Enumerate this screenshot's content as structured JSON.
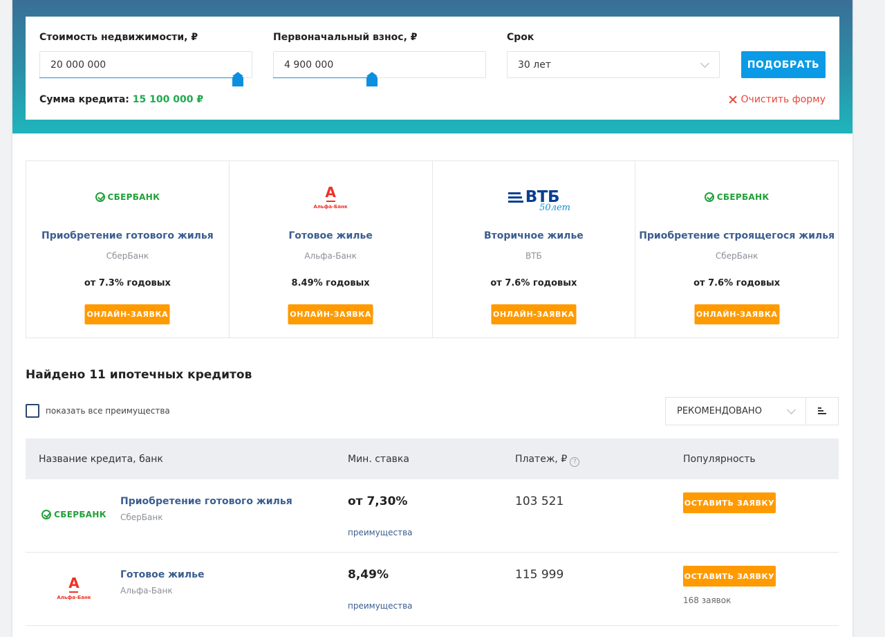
{
  "form": {
    "price_label": "Стоимость недвижимости, ₽",
    "price_value": "20 000 000",
    "down_label": "Первоначальный взнос, ₽",
    "down_value": "4 900 000",
    "term_label": "Срок",
    "term_value": "30 лет",
    "submit_label": "ПОДОБРАТЬ",
    "sum_label": "Сумма кредита:",
    "sum_value": "15 100 000 ₽",
    "clear_label": "Очистить форму",
    "price_slider_fraction": 0.93,
    "down_slider_fraction": 0.46
  },
  "offers": [
    {
      "logo": "sberbank-logo",
      "logo_text": "СБЕРБАНК",
      "title": "Приобретение готового жилья",
      "bank": "СберБанк",
      "rate": "от 7.3% годовых",
      "button": "ОНЛАЙН-ЗАЯВКА"
    },
    {
      "logo": "alfabank-logo",
      "logo_text": "Альфа-Банк",
      "title": "Готовое жилье",
      "bank": "Альфа-Банк",
      "rate": "8.49% годовых",
      "button": "ОНЛАЙН-ЗАЯВКА"
    },
    {
      "logo": "vtb-logo",
      "logo_text": "ВТБ",
      "title": "Вторичное жилье",
      "bank": "ВТБ",
      "rate": "от 7.6% годовых",
      "button": "ОНЛАЙН-ЗАЯВКА"
    },
    {
      "logo": "sberbank-logo",
      "logo_text": "СБЕРБАНК",
      "title": "Приобретение строящегося жилья",
      "bank": "СберБанк",
      "rate": "от 7.6% годовых",
      "button": "ОНЛАЙН-ЗАЯВКА"
    }
  ],
  "results": {
    "found_title": "Найдено 11 ипотечных кредитов",
    "show_benefits_label": "показать все преимущества",
    "sort_value": "РЕКОМЕНДОВАНО",
    "columns": [
      "Название кредита, банк",
      "Мин. ставка",
      "Платеж, ₽",
      "Популярность"
    ],
    "rows": [
      {
        "logo": "sberbank-logo",
        "logo_text": "СБЕРБАНК",
        "name": "Приобретение готового жилья",
        "bank": "СберБанк",
        "rate": "от 7,30%",
        "advantages": "преимущества",
        "payment": "103 521",
        "button": "ОСТАВИТЬ ЗАЯВКУ",
        "count": ""
      },
      {
        "logo": "alfabank-logo",
        "logo_text": "Альфа-Банк",
        "name": "Готовое жилье",
        "bank": "Альфа-Банк",
        "rate": "8,49%",
        "advantages": "преимущества",
        "payment": "115 999",
        "button": "ОСТАВИТЬ ЗАЯВКУ",
        "count": "168 заявок"
      }
    ]
  },
  "colors": {
    "accent_blue": "#0b9be6",
    "orange": "#ff9a00",
    "green_sum": "#1faa4f",
    "clear_red": "#e9463a",
    "link_blue": "#3b5d8f"
  }
}
